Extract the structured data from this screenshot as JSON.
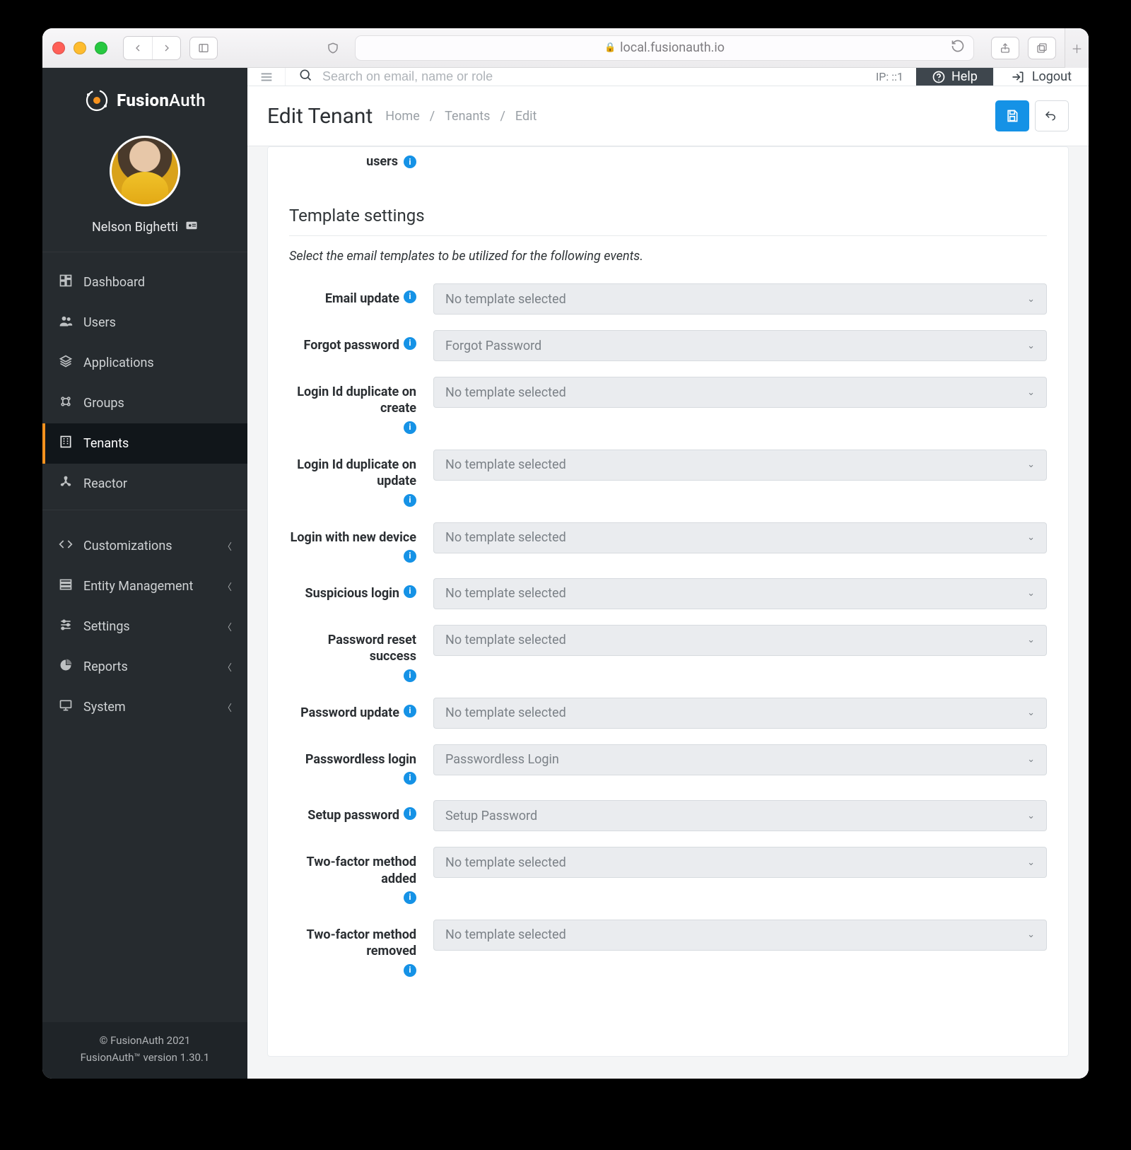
{
  "browser": {
    "url": "local.fusionauth.io"
  },
  "brand": {
    "name_prefix": "Fusion",
    "name_suffix": "Auth"
  },
  "profile": {
    "name": "Nelson Bighetti"
  },
  "sidebar": {
    "items": [
      {
        "label": "Dashboard",
        "icon": "dashboard"
      },
      {
        "label": "Users",
        "icon": "users"
      },
      {
        "label": "Applications",
        "icon": "applications"
      },
      {
        "label": "Groups",
        "icon": "groups"
      },
      {
        "label": "Tenants",
        "icon": "tenants",
        "active": true
      },
      {
        "label": "Reactor",
        "icon": "reactor"
      }
    ],
    "groups": [
      {
        "label": "Customizations",
        "icon": "code"
      },
      {
        "label": "Entity Management",
        "icon": "entity"
      },
      {
        "label": "Settings",
        "icon": "sliders"
      },
      {
        "label": "Reports",
        "icon": "pie"
      },
      {
        "label": "System",
        "icon": "monitor"
      }
    ],
    "footer_line1": "© FusionAuth 2021",
    "footer_line2": "FusionAuth™ version 1.30.1"
  },
  "topbar": {
    "search_placeholder": "Search on email, name or role",
    "ip_label": "IP: ::1",
    "help_label": "Help",
    "logout_label": "Logout"
  },
  "page": {
    "title": "Edit Tenant",
    "crumbs": [
      "Home",
      "Tenants",
      "Edit"
    ]
  },
  "truncated_row_label": "users",
  "section": {
    "title": "Template settings",
    "note": "Select the email templates to be utilized for the following events."
  },
  "templates": [
    {
      "label": "Email update",
      "value": "No template selected"
    },
    {
      "label": "Forgot password",
      "value": "Forgot Password"
    },
    {
      "label": "Login Id duplicate on create",
      "value": "No template selected"
    },
    {
      "label": "Login Id duplicate on update",
      "value": "No template selected"
    },
    {
      "label": "Login with new device",
      "value": "No template selected"
    },
    {
      "label": "Suspicious login",
      "value": "No template selected"
    },
    {
      "label": "Password reset success",
      "value": "No template selected"
    },
    {
      "label": "Password update",
      "value": "No template selected"
    },
    {
      "label": "Passwordless login",
      "value": "Passwordless Login"
    },
    {
      "label": "Setup password",
      "value": "Setup Password"
    },
    {
      "label": "Two-factor method added",
      "value": "No template selected"
    },
    {
      "label": "Two-factor method removed",
      "value": "No template selected"
    }
  ]
}
